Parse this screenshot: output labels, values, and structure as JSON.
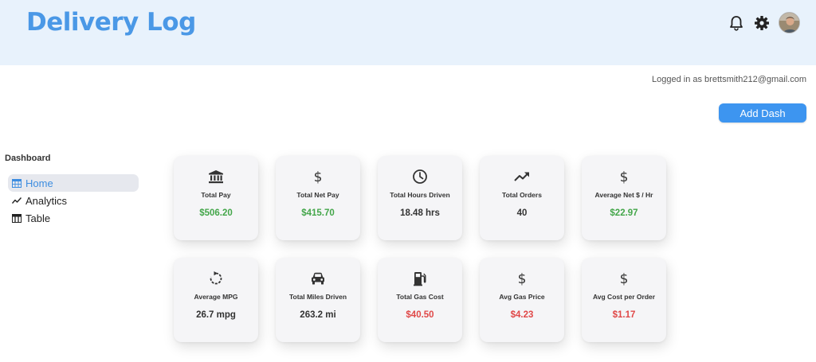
{
  "header": {
    "title": "Delivery Log",
    "icons": [
      "bell-icon",
      "gear-icon"
    ],
    "avatar": "user-avatar"
  },
  "session": {
    "logged_in_text": "Logged in as brettsmith212@gmail.com"
  },
  "actions": {
    "add_label": "Add Dash",
    "accent_color": "#3d95f0"
  },
  "sidebar": {
    "heading": "Dashboard",
    "items": [
      {
        "label": "Home",
        "icon": "calendar-view-icon",
        "active": true
      },
      {
        "label": "Analytics",
        "icon": "trending-line-icon",
        "active": false
      },
      {
        "label": "Table",
        "icon": "table-icon",
        "active": false
      }
    ]
  },
  "stats": [
    {
      "label": "Total Pay",
      "value": "$506.20",
      "icon": "bank-icon",
      "tone": "green"
    },
    {
      "label": "Total Net Pay",
      "value": "$415.70",
      "icon": "dollar-icon",
      "tone": "green"
    },
    {
      "label": "Total Hours Driven",
      "value": "18.48 hrs",
      "icon": "clock-icon",
      "tone": "dark"
    },
    {
      "label": "Total Orders",
      "value": "40",
      "icon": "trending-up-icon",
      "tone": "dark"
    },
    {
      "label": "Average Net $ / Hr",
      "value": "$22.97",
      "icon": "dollar-icon",
      "tone": "green"
    },
    {
      "label": "Average MPG",
      "value": "26.7 mpg",
      "icon": "rotate-icon",
      "tone": "dark"
    },
    {
      "label": "Total Miles Driven",
      "value": "263.2 mi",
      "icon": "car-icon",
      "tone": "dark"
    },
    {
      "label": "Total Gas Cost",
      "value": "$40.50",
      "icon": "gas-pump-icon",
      "tone": "red"
    },
    {
      "label": "Avg Gas Price",
      "value": "$4.23",
      "icon": "dollar-icon",
      "tone": "red"
    },
    {
      "label": "Avg Cost per Order",
      "value": "$1.17",
      "icon": "dollar-icon",
      "tone": "red"
    }
  ],
  "colors": {
    "positive": "#44a64a",
    "negative": "#e04848",
    "header_bg": "#e8f2fc",
    "title": "#4a98e6"
  }
}
